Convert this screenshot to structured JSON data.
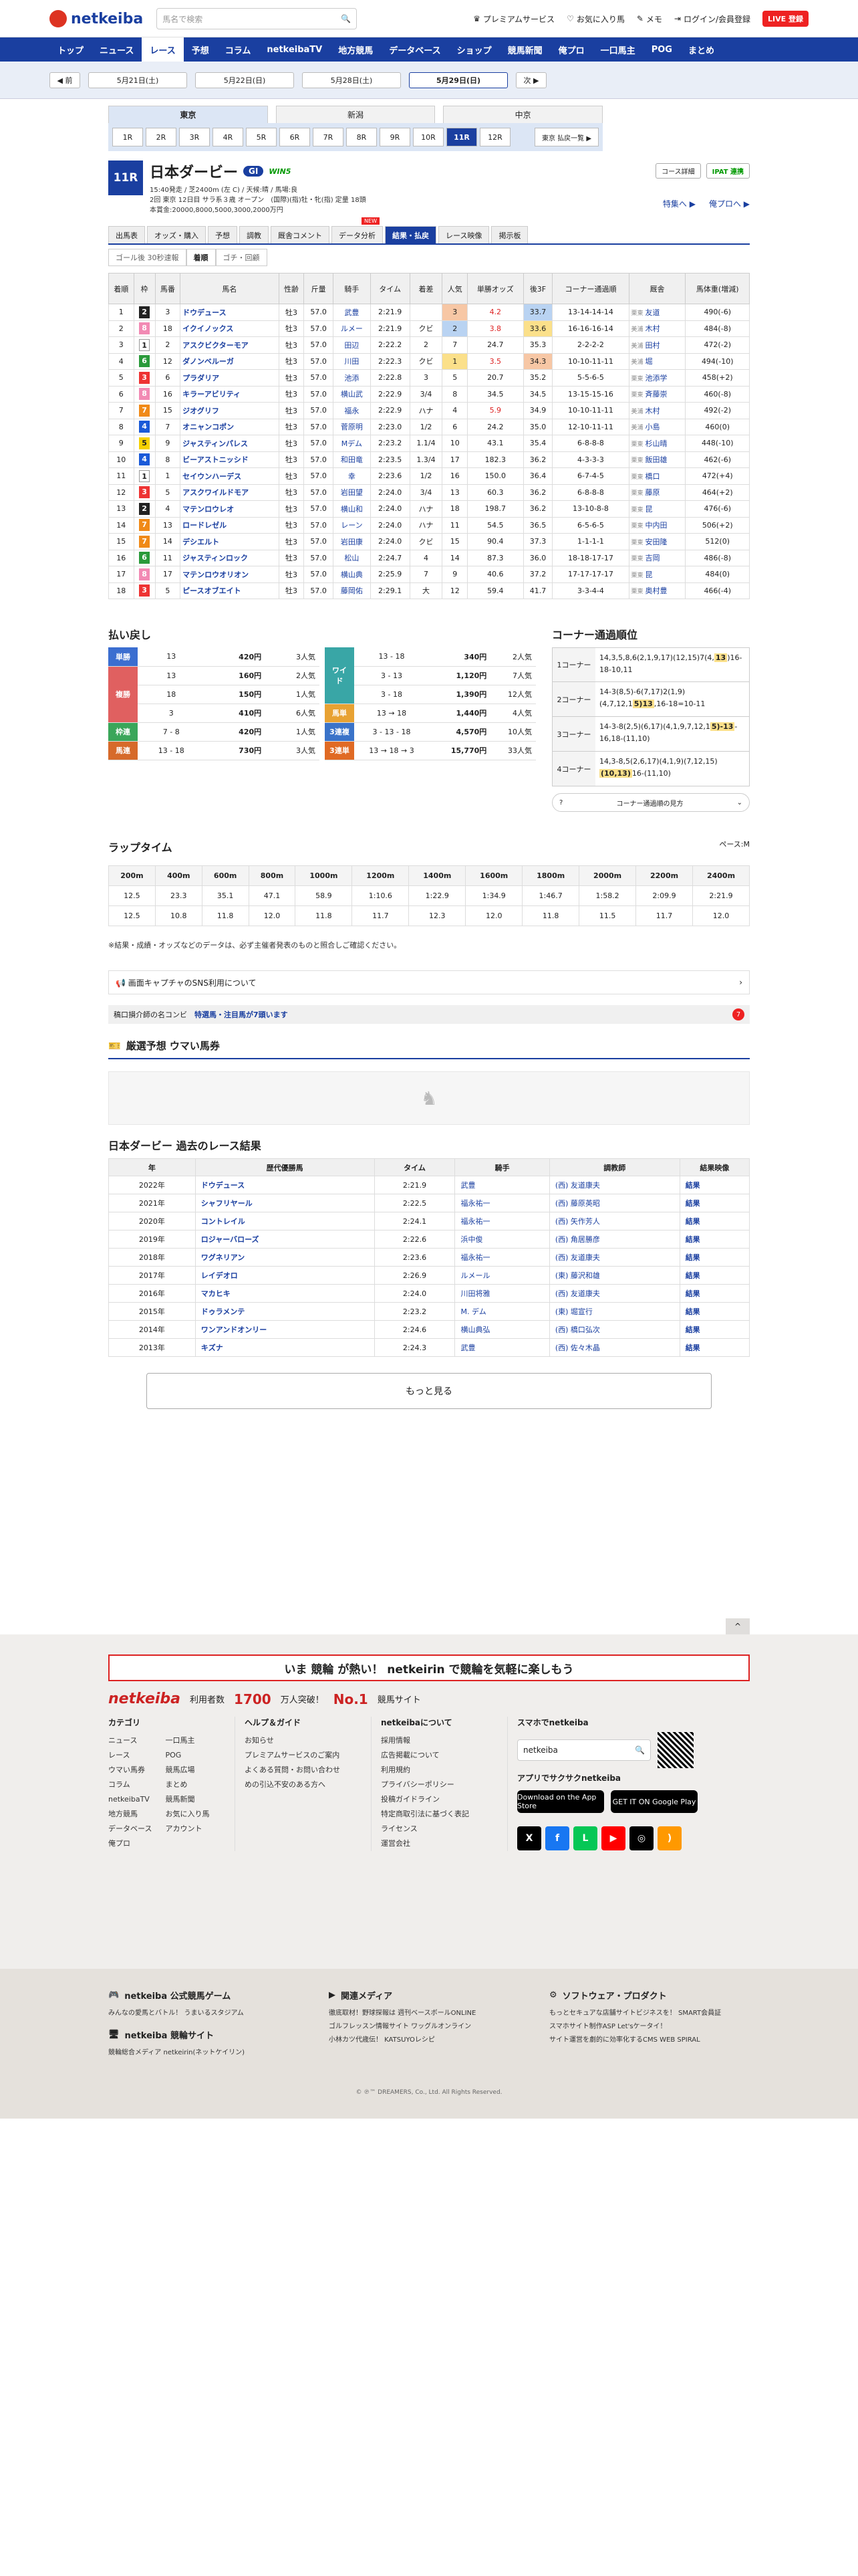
{
  "header": {
    "logo": "netkeiba",
    "search_placeholder": "馬名で検索",
    "links": [
      "プレミアムサービス",
      "お気に入り馬",
      "メモ",
      "ログイン/会員登録"
    ],
    "register": "LIVE 登録"
  },
  "gnav": [
    "トップ",
    "ニュース",
    "レース",
    "予想",
    "コラム",
    "netkeibaTV",
    "地方競馬",
    "データベース",
    "ショップ",
    "競馬新聞",
    "俺プロ",
    "一口馬主",
    "POG",
    "まとめ"
  ],
  "subnav": {
    "prev": "◀ 前",
    "dates": [
      "5月21日(土)",
      "5月22日(日)",
      "5月28日(土)",
      "5月29日(日)"
    ],
    "next": "次 ▶"
  },
  "venues": [
    "東京",
    "新潟",
    "中京"
  ],
  "race_numbers": [
    "1R",
    "2R",
    "3R",
    "4R",
    "5R",
    "6R",
    "7R",
    "8R",
    "9R",
    "10R",
    "11R",
    "12R"
  ],
  "race_next": "東京 払戻一覧 ▶",
  "race": {
    "num": "11R",
    "name": "日本ダービー",
    "grade": "GI",
    "win5": "WIN5",
    "line1": "15:40発走 / 芝2400m (左 C) / 天候:晴 / 馬場:良",
    "line2": "2回 東京 12日目 サラ系３歳 オープン　(国際)(指)牡・牝(指) 定量 18頭",
    "line3": "本賞金:20000,8000,5000,3000,2000万円",
    "tools": [
      "コース詳細",
      "IPAT 連携"
    ],
    "links": [
      "特集へ ▶",
      "俺プロへ ▶"
    ]
  },
  "race_tabs": [
    "出馬表",
    "オッズ・購入",
    "予想",
    "調教",
    "厩舎コメント",
    "データ分析",
    "結果・払戻",
    "レース映像",
    "掲示板"
  ],
  "race_tabs_new": "NEW",
  "sub_tabs": [
    "ゴール後 30秒速報",
    "着順",
    "ゴチ・回顧"
  ],
  "result_headers": [
    "着順",
    "枠",
    "馬番",
    "馬名",
    "性齢",
    "斤量",
    "騎手",
    "タイム",
    "着差",
    "人気",
    "単勝オッズ",
    "後3F",
    "コーナー通過順",
    "厩舎",
    "馬体重(増減)"
  ],
  "results": [
    [
      "1",
      "2",
      "3",
      "ドウデュース",
      "牡3",
      "57.0",
      "武豊",
      "2:21.9",
      "",
      "3",
      "4.2",
      "33.7",
      "13-14-14-14",
      "栗東",
      "友道",
      "490(-6)"
    ],
    [
      "2",
      "8",
      "18",
      "イクイノックス",
      "牡3",
      "57.0",
      "ルメー",
      "2:21.9",
      "クビ",
      "2",
      "3.8",
      "33.6",
      "16-16-16-14",
      "美浦",
      "木村",
      "484(-8)"
    ],
    [
      "3",
      "1",
      "2",
      "アスクビクターモア",
      "牡3",
      "57.0",
      "田辺",
      "2:22.2",
      "2",
      "7",
      "24.7",
      "35.3",
      "2-2-2-2",
      "美浦",
      "田村",
      "472(-2)"
    ],
    [
      "4",
      "6",
      "12",
      "ダノンベルーガ",
      "牡3",
      "57.0",
      "川田",
      "2:22.3",
      "クビ",
      "1",
      "3.5",
      "34.3",
      "10-10-11-11",
      "美浦",
      "堀",
      "494(-10)"
    ],
    [
      "5",
      "3",
      "6",
      "プラダリア",
      "牡3",
      "57.0",
      "池添",
      "2:22.8",
      "3",
      "5",
      "20.7",
      "35.2",
      "5-5-6-5",
      "栗東",
      "池添学",
      "458(+2)"
    ],
    [
      "6",
      "8",
      "16",
      "キラーアビリティ",
      "牡3",
      "57.0",
      "横山武",
      "2:22.9",
      "3/4",
      "8",
      "34.5",
      "34.5",
      "13-15-15-16",
      "栗東",
      "斉藤崇",
      "460(-8)"
    ],
    [
      "7",
      "7",
      "15",
      "ジオグリフ",
      "牡3",
      "57.0",
      "福永",
      "2:22.9",
      "ハナ",
      "4",
      "5.9",
      "34.9",
      "10-10-11-11",
      "美浦",
      "木村",
      "492(-2)"
    ],
    [
      "8",
      "4",
      "7",
      "オニャンコポン",
      "牡3",
      "57.0",
      "菅原明",
      "2:23.0",
      "1/2",
      "6",
      "24.2",
      "35.0",
      "12-10-11-11",
      "美浦",
      "小島",
      "460(0)"
    ],
    [
      "9",
      "5",
      "9",
      "ジャスティンパレス",
      "牡3",
      "57.0",
      "Mデム",
      "2:23.2",
      "1.1/4",
      "10",
      "43.1",
      "35.4",
      "6-8-8-8",
      "栗東",
      "杉山晴",
      "448(-10)"
    ],
    [
      "10",
      "4",
      "8",
      "ビーアストニッシド",
      "牡3",
      "57.0",
      "和田竜",
      "2:23.5",
      "1.3/4",
      "17",
      "182.3",
      "36.2",
      "4-3-3-3",
      "栗東",
      "飯田雄",
      "462(-6)"
    ],
    [
      "11",
      "1",
      "1",
      "セイウンハーデス",
      "牡3",
      "57.0",
      "幸",
      "2:23.6",
      "1/2",
      "16",
      "150.0",
      "36.4",
      "6-7-4-5",
      "栗東",
      "橋口",
      "472(+4)"
    ],
    [
      "12",
      "3",
      "5",
      "アスクワイルドモア",
      "牡3",
      "57.0",
      "岩田望",
      "2:24.0",
      "3/4",
      "13",
      "60.3",
      "36.2",
      "6-8-8-8",
      "栗東",
      "藤原",
      "464(+2)"
    ],
    [
      "13",
      "2",
      "4",
      "マテンロウレオ",
      "牡3",
      "57.0",
      "横山和",
      "2:24.0",
      "ハナ",
      "18",
      "198.7",
      "36.2",
      "13-10-8-8",
      "栗東",
      "昆",
      "476(-6)"
    ],
    [
      "14",
      "7",
      "13",
      "ロードレゼル",
      "牡3",
      "57.0",
      "レーン",
      "2:24.0",
      "ハナ",
      "11",
      "54.5",
      "36.5",
      "6-5-6-5",
      "栗東",
      "中内田",
      "506(+2)"
    ],
    [
      "15",
      "7",
      "14",
      "デシエルト",
      "牡3",
      "57.0",
      "岩田康",
      "2:24.0",
      "クビ",
      "15",
      "90.4",
      "37.3",
      "1-1-1-1",
      "栗東",
      "安田隆",
      "512(0)"
    ],
    [
      "16",
      "6",
      "11",
      "ジャスティンロック",
      "牡3",
      "57.0",
      "松山",
      "2:24.7",
      "4",
      "14",
      "87.3",
      "36.0",
      "18-18-17-17",
      "栗東",
      "吉岡",
      "486(-8)"
    ],
    [
      "17",
      "8",
      "17",
      "マテンロウオリオン",
      "牡3",
      "57.0",
      "横山典",
      "2:25.9",
      "7",
      "9",
      "40.6",
      "37.2",
      "17-17-17-17",
      "栗東",
      "昆",
      "484(0)"
    ],
    [
      "18",
      "3",
      "5",
      "ピースオブエイト",
      "牡3",
      "57.0",
      "藤岡佑",
      "2:29.1",
      "大",
      "12",
      "59.4",
      "41.7",
      "3-3-4-4",
      "栗東",
      "奥村豊",
      "466(-4)"
    ]
  ],
  "waku_colors": [
    "#ffffff",
    "#222222",
    "#e33",
    "#1a5ad8",
    "#f5d000",
    "#2a9a3a",
    "#f08a18",
    "#f28ab4"
  ],
  "payout": {
    "title": "払い戻し",
    "left": [
      {
        "label": "単勝",
        "color": "#3b6ed0",
        "rows": [
          [
            "13",
            "420円",
            "3人気"
          ]
        ]
      },
      {
        "label": "複勝",
        "color": "#e06060",
        "rows": [
          [
            "13",
            "160円",
            "2人気"
          ],
          [
            "18",
            "150円",
            "1人気"
          ],
          [
            "3",
            "410円",
            "6人気"
          ]
        ]
      },
      {
        "label": "枠連",
        "color": "#3aa65a",
        "rows": [
          [
            "7 - 8",
            "420円",
            "1人気"
          ]
        ]
      },
      {
        "label": "馬連",
        "color": "#d66a2a",
        "rows": [
          [
            "13 - 18",
            "730円",
            "3人気"
          ]
        ]
      }
    ],
    "right": [
      {
        "label": "ワイド",
        "color": "#39a6a6",
        "rows": [
          [
            "13 - 18",
            "340円",
            "2人気"
          ],
          [
            "3 - 13",
            "1,120円",
            "7人気"
          ],
          [
            "3 - 18",
            "1,390円",
            "12人気"
          ]
        ]
      },
      {
        "label": "馬単",
        "color": "#e8a233",
        "rows": [
          [
            "13 → 18",
            "1,440円",
            "4人気"
          ]
        ]
      },
      {
        "label": "3連複",
        "color": "#3a73c9",
        "rows": [
          [
            "3 - 13 - 18",
            "4,570円",
            "10人気"
          ]
        ]
      },
      {
        "label": "3連単",
        "color": "#e06a24",
        "rows": [
          [
            "13 → 18 → 3",
            "15,770円",
            "33人気"
          ]
        ]
      }
    ]
  },
  "corner": {
    "title": "コーナー通過順位",
    "rows": [
      {
        "label": "1コーナー",
        "text": "14,3,5,8,6(2,1,9,17)(12,15)7(4,",
        "hl": "13",
        "rest": ")16-18-10,11"
      },
      {
        "label": "2コーナー",
        "text": "14-3(8,5)-6(7,17)2(1,9)(4,7,12,1",
        "hl": "5)13",
        "rest": ",16-18=10-11"
      },
      {
        "label": "3コーナー",
        "text": "14-3-8(2,5)(6,17)(4,1,9,7,12,1",
        "hl": "5)-13",
        "rest": "-16,18-(11,10)"
      },
      {
        "label": "4コーナー",
        "text": "14,3-8,5(2,6,17)(4,1,9)(7,12,15)",
        "hl": "(10,13)",
        "rest": "16-(11,10)"
      }
    ],
    "guide": "コーナー通過順の見方"
  },
  "laps": {
    "title": "ラップタイム",
    "pace": "ペース:M",
    "dist": [
      "200m",
      "400m",
      "600m",
      "800m",
      "1000m",
      "1200m",
      "1400m",
      "1600m",
      "1800m",
      "2000m",
      "2200m",
      "2400m"
    ],
    "cumulative": [
      "12.5",
      "23.3",
      "35.1",
      "47.1",
      "58.9",
      "1:10.6",
      "1:22.9",
      "1:34.9",
      "1:46.7",
      "1:58.2",
      "2:09.9",
      "2:21.9"
    ],
    "split": [
      "12.5",
      "10.8",
      "11.8",
      "12.0",
      "11.8",
      "11.7",
      "12.3",
      "12.0",
      "11.8",
      "11.5",
      "11.7",
      "12.0"
    ]
  },
  "note": "※結果・成績・オッズなどのデータは、必ず主催者発表のものと照合しご確認ください。",
  "sns_bar": "画面キャプチャのSNS利用について",
  "ticker": {
    "prefix": "稿口損介師の名コンビ",
    "hl": "特選馬・注目馬が7頭います",
    "badge": "7"
  },
  "uma_title": "厳選予想 ウマい馬券",
  "past": {
    "title": "日本ダービー 過去のレース結果",
    "headers": [
      "年",
      "歴代優勝馬",
      "タイム",
      "騎手",
      "調教師",
      "結果映像"
    ],
    "rows": [
      [
        "2022年",
        "ドウデュース",
        "2:21.9",
        "武豊",
        "(西) 友道康夫",
        "結果"
      ],
      [
        "2021年",
        "シャフリヤール",
        "2:22.5",
        "福永祐一",
        "(西) 藤原英昭",
        "結果"
      ],
      [
        "2020年",
        "コントレイル",
        "2:24.1",
        "福永祐一",
        "(西) 矢作芳人",
        "結果"
      ],
      [
        "2019年",
        "ロジャーバローズ",
        "2:22.6",
        "浜中俊",
        "(西) 角居勝彦",
        "結果"
      ],
      [
        "2018年",
        "ワグネリアン",
        "2:23.6",
        "福永祐一",
        "(西) 友道康夫",
        "結果"
      ],
      [
        "2017年",
        "レイデオロ",
        "2:26.9",
        "ルメール",
        "(東) 藤沢和雄",
        "結果"
      ],
      [
        "2016年",
        "マカヒキ",
        "2:24.0",
        "川田将雅",
        "(西) 友道康夫",
        "結果"
      ],
      [
        "2015年",
        "ドゥラメンテ",
        "2:23.2",
        "M. デム",
        "(東) 堀宣行",
        "結果"
      ],
      [
        "2014年",
        "ワンアンドオンリー",
        "2:24.6",
        "横山典弘",
        "(西) 橋口弘次",
        "結果"
      ],
      [
        "2013年",
        "キズナ",
        "2:24.3",
        "武豊",
        "(西) 佐々木晶",
        "結果"
      ]
    ]
  },
  "more": "もっと見る",
  "footer": {
    "banner": "いま 競輪 が熱い！ netkeirin で競輪を気軽に楽しもう",
    "brand": "netkeiba",
    "stats_pre": "利用者数",
    "stats_num": "1700",
    "stats_mid": "万人突破！",
    "stats_no": "No.1",
    "stats_post": "競馬サイト",
    "cat_title": "カテゴリ",
    "cat_a": [
      "ニュース",
      "レース",
      "ウマい馬券",
      "コラム",
      "netkeibaTV",
      "地方競馬",
      "データベース",
      "俺プロ"
    ],
    "cat_b": [
      "一口馬主",
      "POG",
      "競馬広場",
      "まとめ",
      "競馬新聞",
      "お気に入り馬",
      "アカウント"
    ],
    "help_title": "ヘルプ＆ガイド",
    "help": [
      "お知らせ",
      "プレミアムサービスのご案内",
      "よくある質問・お問い合わせ",
      "めの引込不安のある方へ"
    ],
    "about_title": "netkeibaについて",
    "about": [
      "採用情報",
      "広告掲載について",
      "利用規約",
      "プライバシーポリシー",
      "投稿ガイドライン",
      "特定商取引法に基づく表記",
      "ライセンス",
      "運営会社"
    ],
    "phone_title": "スマホでnetkeiba",
    "phone_search": "netkeiba",
    "app_title": "アプリでサクサクnetkeiba",
    "appstore": "Download on the App Store",
    "gplay": "GET IT ON Google Play",
    "b1_title": "netkeiba 公式競馬ゲーム",
    "b1": [
      "みんなの愛馬とバトル！ うまいるスタジアム"
    ],
    "b2_title": "netkeiba 競輪サイト",
    "b2": [
      "競輪総合メディア netkeirin(ネットケイリン)"
    ],
    "b3_title": "関連メディア",
    "b3": [
      "徹底取材！野球探報は 週刊ベースボールONLINE",
      "ゴルフレッスン情報サイト ワッグルオンライン",
      "小林カツ代歳伝！ KATSUYOレシピ"
    ],
    "b4_title": "ソフトウェア・プロダクト",
    "b4": [
      "もっとセキュアな店舗サイトビジネスを！ SMART会員証",
      "スマホサイト制作ASP Let'sケータイ！",
      "サイト運営を劇的に効率化するCMS WEB SPIRAL"
    ],
    "copyright": "© ℗™ DREAMERS, Co., Ltd. All Rights Reserved."
  }
}
